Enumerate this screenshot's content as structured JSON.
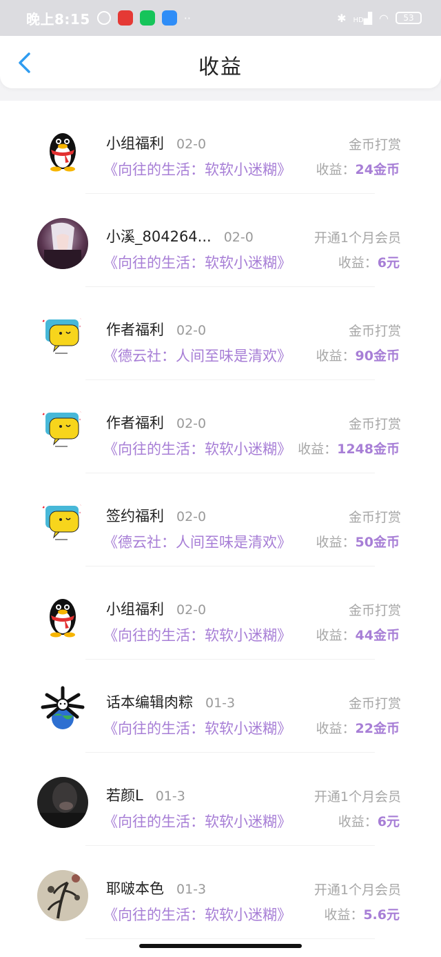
{
  "status_bar": {
    "time": "晚上8:15",
    "dots": "··",
    "network": "HD",
    "battery": "53"
  },
  "header": {
    "title": "收益"
  },
  "earn_prefix": "收益：",
  "rows": [
    {
      "avatar": "qq-penguin-avatar",
      "name": "小组福利",
      "date": "02-0",
      "book": "《向往的生活：软软小迷糊》",
      "type": "金币打赏",
      "amount": "24金币"
    },
    {
      "avatar": "anime-character-avatar",
      "name": "小溪_804264...",
      "date": "02-0",
      "book": "《向往的生活：软软小迷糊》",
      "type": "开通1个月会员",
      "amount": "6元"
    },
    {
      "avatar": "chat-bubble-avatar",
      "name": "作者福利",
      "date": "02-0",
      "book": "《德云社：人间至味是清欢》",
      "type": "金币打赏",
      "amount": "90金币"
    },
    {
      "avatar": "chat-bubble-avatar",
      "name": "作者福利",
      "date": "02-0",
      "book": "《向往的生活：软软小迷糊》",
      "type": "金币打赏",
      "amount": "1248金币"
    },
    {
      "avatar": "chat-bubble-avatar",
      "name": "签约福利",
      "date": "02-0",
      "book": "《德云社：人间至味是清欢》",
      "type": "金币打赏",
      "amount": "50金币"
    },
    {
      "avatar": "qq-penguin-avatar",
      "name": "小组福利",
      "date": "02-0",
      "book": "《向往的生活：软软小迷糊》",
      "type": "金币打赏",
      "amount": "44金币"
    },
    {
      "avatar": "rice-dumpling-avatar",
      "name": "话本编辑肉粽",
      "date": "01-3",
      "book": "《向往的生活：软软小迷糊》",
      "type": "金币打赏",
      "amount": "22金币"
    },
    {
      "avatar": "dark-portrait-avatar",
      "name": "若颜L",
      "date": "01-3",
      "book": "《向往的生活：软软小迷糊》",
      "type": "开通1个月会员",
      "amount": "6元"
    },
    {
      "avatar": "ink-painting-avatar",
      "name": "耶啵本色",
      "date": "01-3",
      "book": "《向往的生活：软软小迷糊》",
      "type": "开通1个月会员",
      "amount": "5.6元"
    }
  ],
  "colors": {
    "accent_purple": "#a77ed6",
    "back_blue": "#2f9cf0",
    "status_bar_bg": "#dcdce0"
  }
}
